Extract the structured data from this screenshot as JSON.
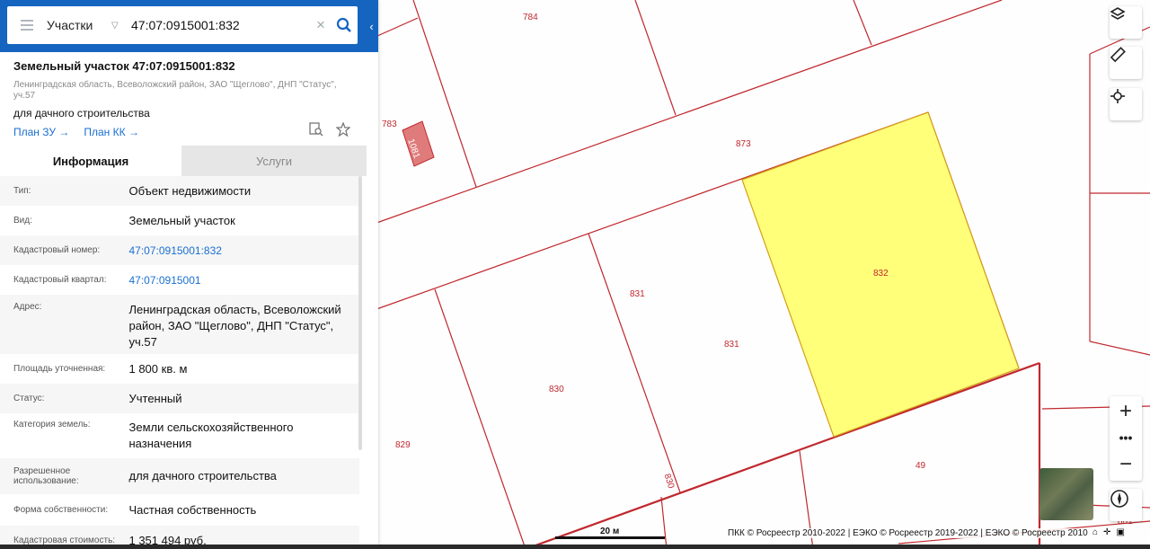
{
  "search": {
    "scope": "Участки",
    "query": "47:07:0915001:832"
  },
  "summary": {
    "title": "Земельный участок 47:07:0915001:832",
    "address": "Ленинградская область, Всеволожский район, ЗАО \"Щеглово\", ДНП \"Статус\", уч.57",
    "purpose": "для дачного строительства",
    "plan_zu": "План ЗУ",
    "plan_kk": "План КК"
  },
  "tabs": {
    "info": "Информация",
    "services": "Услуги"
  },
  "info": [
    {
      "label": "Тип:",
      "value": "Объект недвижимости"
    },
    {
      "label": "Вид:",
      "value": "Земельный участок"
    },
    {
      "label": "Кадастровый номер:",
      "value": "47:07:0915001:832"
    },
    {
      "label": "Кадастровый квартал:",
      "value": "47:07:0915001"
    },
    {
      "label": "Адрес:",
      "value": "Ленинградская область, Всеволожский район, ЗАО \"Щеглово\", ДНП \"Статус\", уч.57"
    },
    {
      "label": "Площадь уточненная:",
      "value": "1 800 кв. м"
    },
    {
      "label": "Статус:",
      "value": "Учтенный"
    },
    {
      "label": "Категория земель:",
      "value": "Земли сельскохозяйственного назначения"
    },
    {
      "label": "Разрешенное использование:",
      "value": "для дачного строительства"
    },
    {
      "label": "Форма собственности:",
      "value": "Частная собственность"
    },
    {
      "label": "Кадастровая стоимость:",
      "value": "1 351 494 руб."
    }
  ],
  "map": {
    "parcels": [
      "784",
      "783",
      "1081",
      "873",
      "832",
      "831",
      "831",
      "830",
      "830",
      "829",
      "49",
      "861"
    ],
    "scale": "20 м",
    "attribution": "ПКК © Росреестр 2010-2022 | ЕЭКО © Росреестр 2019-2022 | ЕЭКО © Росреестр 2010",
    "colors": {
      "boundary": "#c0282e",
      "selected_fill": "#ffff7a",
      "selected_border": "#d4a017",
      "accent": "#1565c0"
    }
  },
  "controls": {
    "layers": "layers-icon",
    "ruler": "ruler-icon",
    "locate": "locate-icon",
    "zoom_in": "plus-icon",
    "more": "more-icon",
    "zoom_out": "minus-icon",
    "compass": "compass-icon"
  }
}
